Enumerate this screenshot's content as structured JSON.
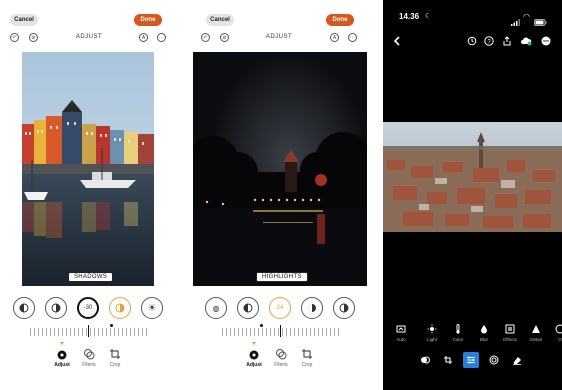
{
  "left": {
    "cancel_label": "Cancel",
    "done_label": "Done",
    "title": "ADJUST",
    "chip": "SHADOWS",
    "tool_value": "-30",
    "tabs": [
      {
        "label": "Adjust",
        "active": true,
        "icon": "adjust-dial-icon"
      },
      {
        "label": "Filters",
        "active": false,
        "icon": "filters-icon"
      },
      {
        "label": "Crop",
        "active": false,
        "icon": "crop-icon"
      }
    ]
  },
  "middle": {
    "cancel_label": "Cancel",
    "done_label": "Done",
    "title": "ADJUST",
    "chip": "HIGHLIGHTS",
    "tool_value": "24",
    "tabs": [
      {
        "label": "Adjust",
        "active": true,
        "icon": "adjust-dial-icon"
      },
      {
        "label": "Filters",
        "active": false,
        "icon": "filters-icon"
      },
      {
        "label": "Crop",
        "active": false,
        "icon": "crop-icon"
      }
    ]
  },
  "right": {
    "time": "14.36",
    "tools": [
      {
        "label": "Auto",
        "icon": "auto-icon"
      },
      {
        "label": "Light",
        "icon": "sun-icon"
      },
      {
        "label": "Color",
        "icon": "thermometer-icon"
      },
      {
        "label": "Blur",
        "icon": "drop-icon"
      },
      {
        "label": "Effects",
        "icon": "effects-icon"
      },
      {
        "label": "Detail",
        "icon": "triangle-icon"
      },
      {
        "label": "O",
        "icon": "optics-icon"
      }
    ]
  },
  "colors": {
    "accent_orange": "#d4591f",
    "selection_blue": "#2a7fdc",
    "highlight_yellow": "#e4a23a"
  }
}
